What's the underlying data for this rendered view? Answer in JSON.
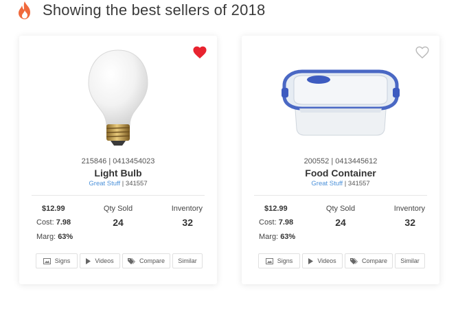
{
  "header": {
    "title": "Showing the best sellers of 2018",
    "icon": "flame-icon",
    "accent": "#f0693c"
  },
  "products": [
    {
      "favorited": true,
      "ids": "215846 | 0413454023",
      "name": "Light Bulb",
      "brand": "Great Stuff",
      "vendor_id": "341557",
      "price": "$12.99",
      "cost_label": "Cost: ",
      "cost_value": "7.98",
      "marg_label": "Marg: ",
      "marg_value": "63%",
      "qty_label": "Qty Sold",
      "qty_value": "24",
      "inv_label": "Inventory",
      "inv_value": "32"
    },
    {
      "favorited": false,
      "ids": "200552 | 0413445612",
      "name": "Food Container",
      "brand": "Great Stuff",
      "vendor_id": "341557",
      "price": "$12.99",
      "cost_label": "Cost: ",
      "cost_value": "7.98",
      "marg_label": "Marg: ",
      "marg_value": "63%",
      "qty_label": "Qty Sold",
      "qty_value": "24",
      "inv_label": "Inventory",
      "inv_value": "32"
    }
  ],
  "actions": {
    "signs": "Signs",
    "videos": "Videos",
    "compare": "Compare",
    "similar": "Similar"
  },
  "colors": {
    "heart_active": "#e8232f",
    "heart_inactive": "#bbbbbb",
    "link": "#4a90d9"
  }
}
